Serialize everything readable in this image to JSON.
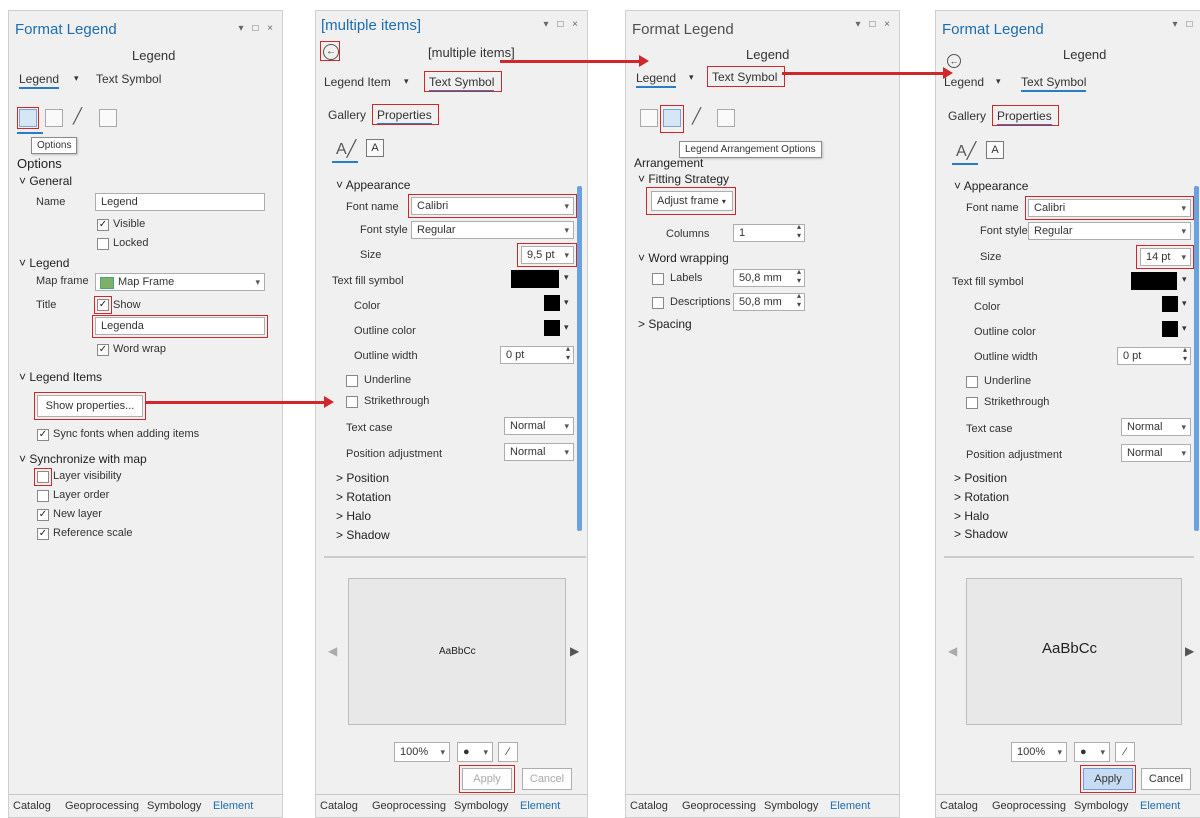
{
  "panel1": {
    "title": "Format Legend",
    "window_controls": "▾ □ ×",
    "subtitle": "Legend",
    "nav_legend": "Legend",
    "nav_text_symbol": "Text Symbol",
    "tooltip": "Options",
    "options_header": "Options",
    "general_header": "General",
    "name_label": "Name",
    "name_value": "Legend",
    "visible_label": "Visible",
    "locked_label": "Locked",
    "legend_header": "Legend",
    "map_frame_label": "Map frame",
    "map_frame_value": "Map Frame",
    "title_label": "Title",
    "show_label": "Show",
    "title_value": "Legenda",
    "word_wrap_label": "Word wrap",
    "legend_items_header": "Legend Items",
    "show_properties_button": "Show properties...",
    "sync_fonts_label": "Sync fonts when adding items",
    "sync_header": "Synchronize with map",
    "layer_visibility_label": "Layer visibility",
    "layer_order_label": "Layer order",
    "new_layer_label": "New layer",
    "reference_scale_label": "Reference scale"
  },
  "panel2": {
    "title": "[multiple items]",
    "window_controls": "▾ □ ×",
    "subtitle": "[multiple items]",
    "nav_legend_item": "Legend Item",
    "nav_text_symbol": "Text Symbol",
    "gallery_tab": "Gallery",
    "properties_tab": "Properties",
    "appearance_header": "Appearance",
    "font_name_label": "Font name",
    "font_name_value": "Calibri",
    "font_style_label": "Font style",
    "font_style_value": "Regular",
    "size_label": "Size",
    "size_value": "9,5 pt",
    "text_fill_label": "Text fill symbol",
    "color_label": "Color",
    "outline_color_label": "Outline color",
    "outline_width_label": "Outline width",
    "outline_width_value": "0 pt",
    "underline_label": "Underline",
    "strikethrough_label": "Strikethrough",
    "text_case_label": "Text case",
    "text_case_value": "Normal",
    "position_adj_label": "Position adjustment",
    "position_adj_value": "Normal",
    "position_header": "Position",
    "rotation_header": "Rotation",
    "halo_header": "Halo",
    "shadow_header": "Shadow",
    "preview_text": "AaBbCc",
    "zoom_value": "100%",
    "apply_button": "Apply",
    "cancel_button": "Cancel"
  },
  "panel3": {
    "title": "Format Legend",
    "window_controls": "▾ □ ×",
    "subtitle": "Legend",
    "nav_legend": "Legend",
    "nav_text_symbol": "Text Symbol",
    "tooltip": "Legend Arrangement Options",
    "arrangement_header": "Arrangement",
    "fitting_header": "Fitting Strategy",
    "fitting_value": "Adjust frame",
    "columns_label": "Columns",
    "columns_value": "1",
    "word_wrapping_header": "Word wrapping",
    "labels_label": "Labels",
    "labels_value": "50,8 mm",
    "descriptions_label": "Descriptions",
    "descriptions_value": "50,8 mm",
    "spacing_header": "Spacing"
  },
  "panel4": {
    "title": "Format Legend",
    "window_controls": "▾ □ ×",
    "subtitle": "Legend",
    "nav_legend": "Legend",
    "nav_text_symbol": "Text Symbol",
    "gallery_tab": "Gallery",
    "properties_tab": "Properties",
    "appearance_header": "Appearance",
    "font_name_label": "Font name",
    "font_name_value": "Calibri",
    "font_style_label": "Font style",
    "font_style_value": "Regular",
    "size_label": "Size",
    "size_value": "14 pt",
    "text_fill_label": "Text fill symbol",
    "color_label": "Color",
    "outline_color_label": "Outline color",
    "outline_width_label": "Outline width",
    "outline_width_value": "0 pt",
    "underline_label": "Underline",
    "strikethrough_label": "Strikethrough",
    "text_case_label": "Text case",
    "text_case_value": "Normal",
    "position_adj_label": "Position adjustment",
    "position_adj_value": "Normal",
    "position_header": "Position",
    "rotation_header": "Rotation",
    "halo_header": "Halo",
    "shadow_header": "Shadow",
    "preview_text": "AaBbCc",
    "zoom_value": "100%",
    "apply_button": "Apply",
    "cancel_button": "Cancel"
  },
  "bottom_tabs": [
    "Catalog",
    "Geoprocessing",
    "Symbology",
    "Element"
  ],
  "colors": {
    "accent": "#1c6eb0",
    "highlight": "#d0282a"
  }
}
